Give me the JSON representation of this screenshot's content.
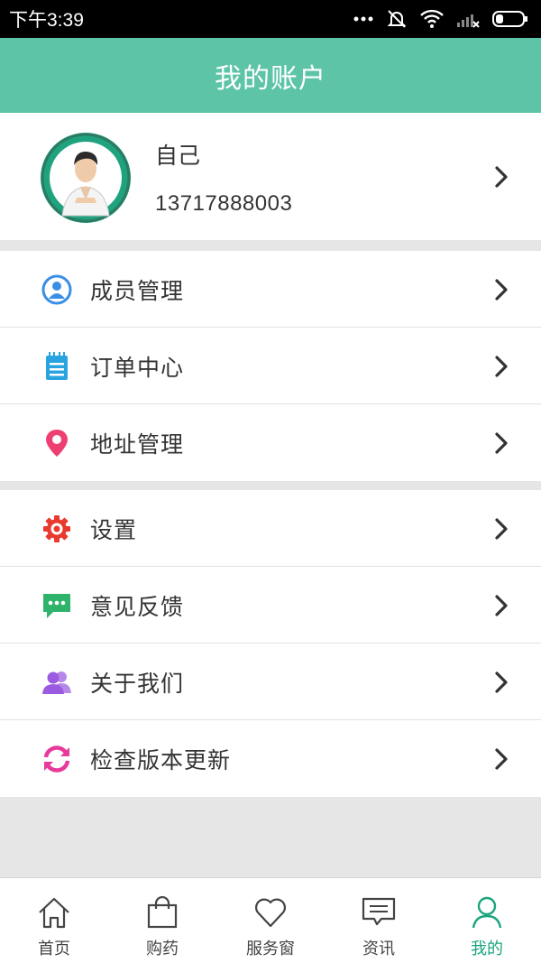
{
  "statusbar": {
    "time": "下午3:39"
  },
  "header": {
    "title": "我的账户"
  },
  "profile": {
    "name": "自己",
    "phone": "13717888003"
  },
  "menu_group1": [
    {
      "label": "成员管理",
      "icon": "user-circle-icon",
      "color": "#3a8ee6"
    },
    {
      "label": "订单中心",
      "icon": "notepad-icon",
      "color": "#2aa4e0"
    },
    {
      "label": "地址管理",
      "icon": "location-pin-icon",
      "color": "#ee3f73"
    }
  ],
  "menu_group2": [
    {
      "label": "设置",
      "icon": "gear-icon",
      "color": "#e83a2e"
    },
    {
      "label": "意见反馈",
      "icon": "chat-bubble-icon",
      "color": "#2fb36b"
    },
    {
      "label": "关于我们",
      "icon": "group-users-icon",
      "color": "#9b5be0"
    },
    {
      "label": "检查版本更新",
      "icon": "refresh-icon",
      "color": "#e83a9c"
    }
  ],
  "tabbar": [
    {
      "label": "首页",
      "icon": "home-icon"
    },
    {
      "label": "购药",
      "icon": "shopping-bag-icon"
    },
    {
      "label": "服务窗",
      "icon": "heart-icon"
    },
    {
      "label": "资讯",
      "icon": "message-icon"
    },
    {
      "label": "我的",
      "icon": "person-icon",
      "active": true
    }
  ],
  "colors": {
    "accent": "#5ec4a8",
    "active_tab": "#1aa57e"
  }
}
